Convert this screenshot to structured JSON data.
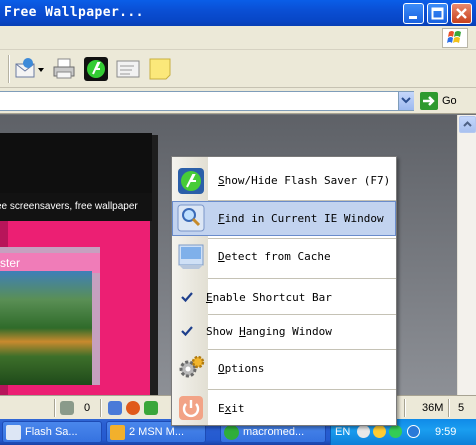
{
  "window": {
    "title": "Free Wallpaper...",
    "buttons": [
      "minimize",
      "maximize",
      "close"
    ]
  },
  "toolbar": {
    "icons": [
      "mail-icon",
      "print-icon",
      "flash-saver-icon",
      "edit-icon",
      "notes-icon"
    ]
  },
  "address": {
    "go_label": "Go"
  },
  "page": {
    "banner_text": "ee screensavers, free wallpaper",
    "caption_text": "ster"
  },
  "context_menu": {
    "items": [
      {
        "label": "Show/Hide Flash Saver (F7)",
        "icon": "flash-saver-icon",
        "highlighted": false,
        "accelerator_char": "S"
      },
      {
        "label": "Find in Current IE Window",
        "icon": "magnifier-icon",
        "highlighted": true,
        "accelerator_char": "F"
      },
      {
        "label": "Detect from Cache",
        "icon": "cache-icon",
        "highlighted": false,
        "accelerator_char": "D"
      },
      {
        "label": "Enable Shortcut Bar",
        "checked": true,
        "accelerator_char": "E"
      },
      {
        "label": "Show Hanging Window",
        "checked": true,
        "accelerator_char": "H"
      },
      {
        "label": "Options",
        "icon": "gears-icon",
        "highlighted": false,
        "accelerator_char": "O"
      },
      {
        "label": "Exit",
        "icon": "power-icon",
        "highlighted": false,
        "accelerator_char": "x"
      }
    ]
  },
  "statusbar": {
    "count_1": "0",
    "memory": "36M",
    "count_2": "5"
  },
  "taskbar": {
    "tasks": [
      {
        "label": "Flash Sa..."
      },
      {
        "label": "2 MSN M..."
      },
      {
        "label": "macromed..."
      }
    ],
    "tray": {
      "lang": "EN",
      "clock": "9:59"
    }
  },
  "colors": {
    "menu_highlight": "#c2d3ef",
    "menu_highlight_border": "#6a8ccb",
    "title_blue": "#0a4fd4",
    "pink": "#ec1f73"
  }
}
